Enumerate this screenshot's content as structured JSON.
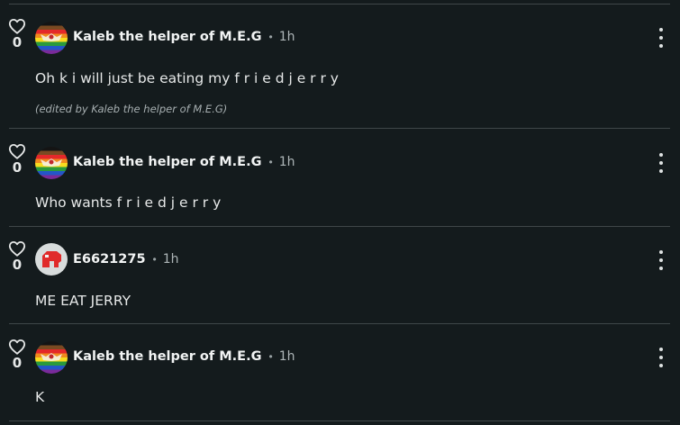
{
  "posts": [
    {
      "likes": "0",
      "username": "Kaleb the helper of M.E.G",
      "separator": "•",
      "time": "1h",
      "text": "Oh k  i will just be eating my f r i e d j e r r y",
      "edited_note": "(edited by Kaleb the helper of M.E.G)",
      "avatar_icon": "rainbow-flag-avatar"
    },
    {
      "likes": "0",
      "username": "Kaleb the helper of M.E.G",
      "separator": "•",
      "time": "1h",
      "text": "Who wants f r i e d j e r r y",
      "avatar_icon": "rainbow-flag-avatar"
    },
    {
      "likes": "0",
      "username": "E6621275",
      "separator": "•",
      "time": "1h",
      "text": "ME EAT JERRY",
      "avatar_icon": "red-block-avatar"
    },
    {
      "likes": "0",
      "username": "Kaleb the helper of M.E.G",
      "separator": "•",
      "time": "1h",
      "text": "K",
      "avatar_icon": "rainbow-flag-avatar"
    }
  ],
  "colors": {
    "background": "#141b1d",
    "divider": "#3f4749",
    "text": "#e6e8e8",
    "muted": "#aeb6b8"
  }
}
